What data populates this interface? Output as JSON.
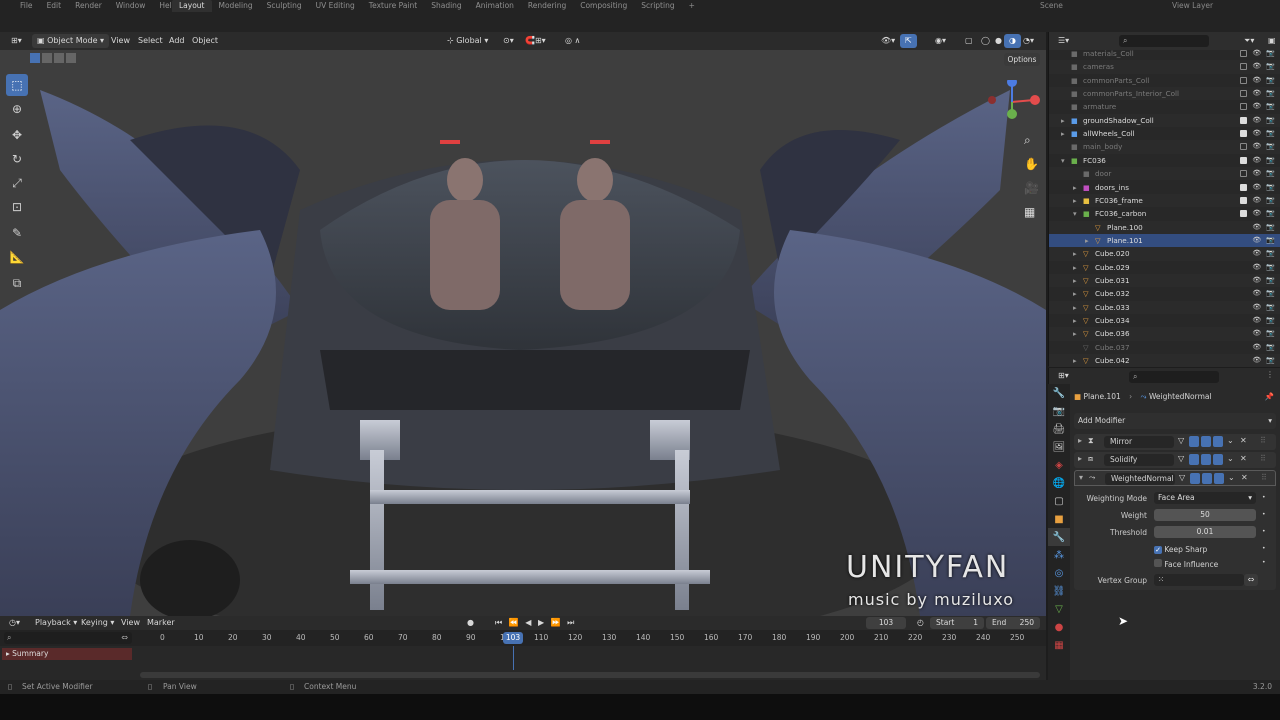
{
  "topbar": {
    "menus": [
      "File",
      "Edit",
      "Render",
      "Window",
      "Help"
    ],
    "workspaces": [
      "Layout",
      "Modeling",
      "Sculpting",
      "UV Editing",
      "Texture Paint",
      "Shading",
      "Animation",
      "Rendering",
      "Compositing",
      "Scripting"
    ],
    "active_workspace": "Layout",
    "scene": "Scene",
    "view_layer": "View Layer"
  },
  "viewport_header": {
    "mode": "Object Mode",
    "menus": [
      "View",
      "Select",
      "Add",
      "Object"
    ],
    "orientation": "Global",
    "options": "Options"
  },
  "watermark": {
    "title": "UNITYFAN",
    "subtitle": "music by muziluxo"
  },
  "outliner": {
    "rows": [
      {
        "name": "materials_Coll",
        "indent": 0,
        "dim": true
      },
      {
        "name": "cameras",
        "indent": 0,
        "dim": true
      },
      {
        "name": "commonParts_Coll",
        "indent": 0,
        "dim": true
      },
      {
        "name": "commonParts_Interior_Coll",
        "indent": 0,
        "dim": true
      },
      {
        "name": "armature",
        "indent": 0,
        "dim": true
      },
      {
        "name": "groundShadow_Coll",
        "indent": 0,
        "dim": false
      },
      {
        "name": "allWheels_Coll",
        "indent": 0,
        "dim": false
      },
      {
        "name": "main_body",
        "indent": 0,
        "dim": true
      },
      {
        "name": "FC036",
        "indent": 0,
        "dim": false
      },
      {
        "name": "door",
        "indent": 1,
        "dim": true
      },
      {
        "name": "doors_ins",
        "indent": 1,
        "dim": false
      },
      {
        "name": "FC036_frame",
        "indent": 1,
        "dim": false
      },
      {
        "name": "FC036_carbon",
        "indent": 1,
        "dim": false
      },
      {
        "name": "Plane.100",
        "indent": 2,
        "dim": false
      },
      {
        "name": "Plane.101",
        "indent": 2,
        "dim": false
      },
      {
        "name": "Cube.020",
        "indent": 1,
        "dim": false
      },
      {
        "name": "Cube.029",
        "indent": 1,
        "dim": false
      },
      {
        "name": "Cube.031",
        "indent": 1,
        "dim": false
      },
      {
        "name": "Cube.032",
        "indent": 1,
        "dim": false
      },
      {
        "name": "Cube.033",
        "indent": 1,
        "dim": false
      },
      {
        "name": "Cube.034",
        "indent": 1,
        "dim": false
      },
      {
        "name": "Cube.036",
        "indent": 1,
        "dim": false
      },
      {
        "name": "Cube.037",
        "indent": 1,
        "dim": true
      },
      {
        "name": "Cube.042",
        "indent": 1,
        "dim": false
      }
    ]
  },
  "properties": {
    "breadcrumb_object": "Plane.101",
    "breadcrumb_modifier": "WeightedNormal",
    "add_modifier": "Add Modifier",
    "modifiers": [
      "Mirror",
      "Solidify",
      "WeightedNormal"
    ],
    "weighting_mode_label": "Weighting Mode",
    "weighting_mode_value": "Face Area",
    "weight_label": "Weight",
    "weight_value": "50",
    "threshold_label": "Threshold",
    "threshold_value": "0.01",
    "keep_sharp": "Keep Sharp",
    "face_influence": "Face Influence",
    "vertex_group": "Vertex Group"
  },
  "timeline": {
    "menus": [
      "Playback",
      "Keying",
      "View",
      "Marker"
    ],
    "current_frame": "103",
    "start_label": "Start",
    "start_value": "1",
    "end_label": "End",
    "end_value": "250",
    "ticks": [
      "0",
      "10",
      "20",
      "30",
      "40",
      "50",
      "60",
      "70",
      "80",
      "90",
      "100",
      "110",
      "120",
      "130",
      "140",
      "150",
      "160",
      "170",
      "180",
      "190",
      "200",
      "210",
      "220",
      "230",
      "240",
      "250"
    ],
    "summary": "Summary"
  },
  "statusbar": {
    "left": "Set Active Modifier",
    "mid": "Pan View",
    "right": "Context Menu",
    "version": "3.2.0"
  }
}
